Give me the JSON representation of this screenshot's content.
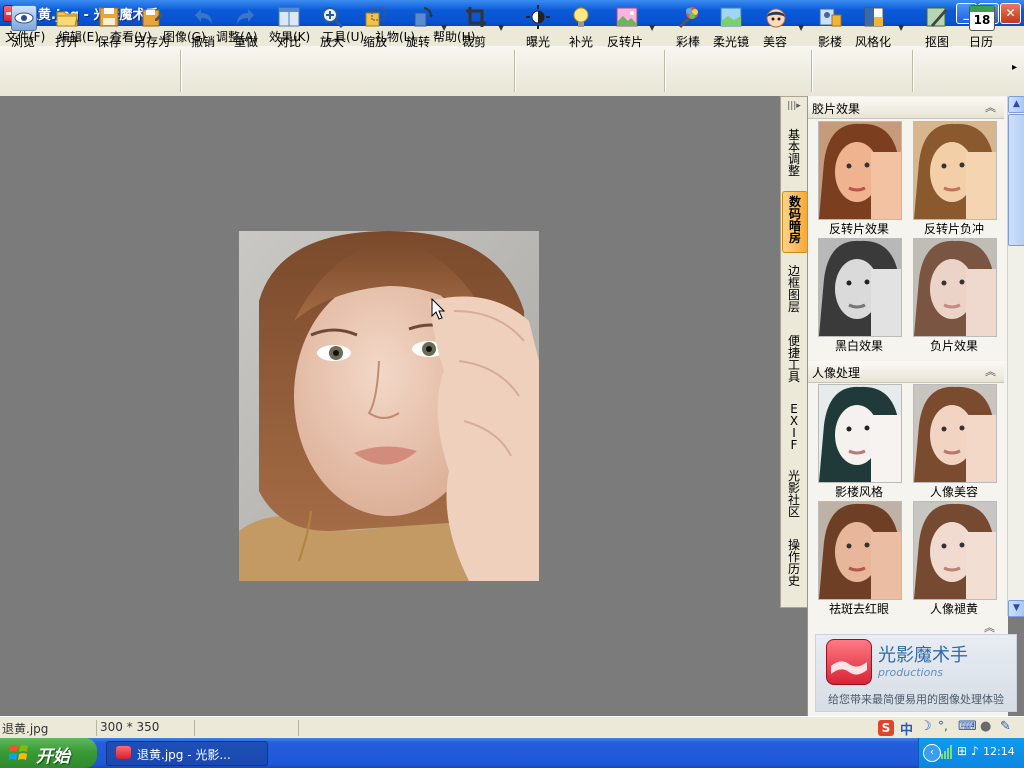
{
  "window": {
    "title": "退黄.jpg - 光影魔术手",
    "buttons": {
      "minimize": "_",
      "maximize": "❐",
      "close": "✕"
    }
  },
  "menu": [
    "文件(F)",
    "编辑(E)",
    "查看(V)",
    "图像(G)",
    "调整(A)",
    "效果(K)",
    "工具(U)",
    "礼物(L)",
    "帮助(H)"
  ],
  "toolbar": {
    "browse": "浏览",
    "open": "打开",
    "save": "保存",
    "save_as": "另存为",
    "undo": "撤销",
    "redo": "重做",
    "compare": "对比",
    "zoom_in": "放大",
    "zoom_out": "缩放",
    "rotate": "旋转",
    "crop": "裁剪",
    "exposure": "曝光",
    "fill_light": "补光",
    "reverse_film": "反转片",
    "color_wand": "彩棒",
    "soft_lens": "柔光镜",
    "beauty": "美容",
    "studio": "影楼",
    "stylize": "风格化",
    "cutout": "抠图",
    "calendar": "日历",
    "calendar_day": "18"
  },
  "vtabs": [
    "基本调整",
    "数码暗房",
    "边框图层",
    "便捷工具",
    "EXIF",
    "光影社区",
    "操作历史"
  ],
  "vtabs_toggle": "|||▸",
  "panel": {
    "section1": {
      "title": "胶片效果",
      "items": [
        "反转片效果",
        "反转片负冲",
        "黑白效果",
        "负片效果"
      ]
    },
    "section2": {
      "title": "人像处理",
      "items": [
        "影楼风格",
        "人像美容",
        "祛斑去红眼",
        "人像褪黄"
      ]
    },
    "collapse_icon": "︽"
  },
  "promo": {
    "name": "光影魔术手",
    "sub": "productions",
    "tagline": "给您带来最简便易用的图像处理体验"
  },
  "status": {
    "filename": "退黄.jpg",
    "dimensions": "300 * 350"
  },
  "ime": {
    "mode": "中"
  },
  "taskbar": {
    "start": "开始",
    "task": "退黄.jpg - 光影...",
    "clock": "12:14"
  },
  "colors": {
    "titlebar": "#0a5ad8",
    "taskbar": "#245edb",
    "start": "#3b9a38",
    "workspace": "#7b7b7b",
    "active_tab": "#f6a935"
  }
}
